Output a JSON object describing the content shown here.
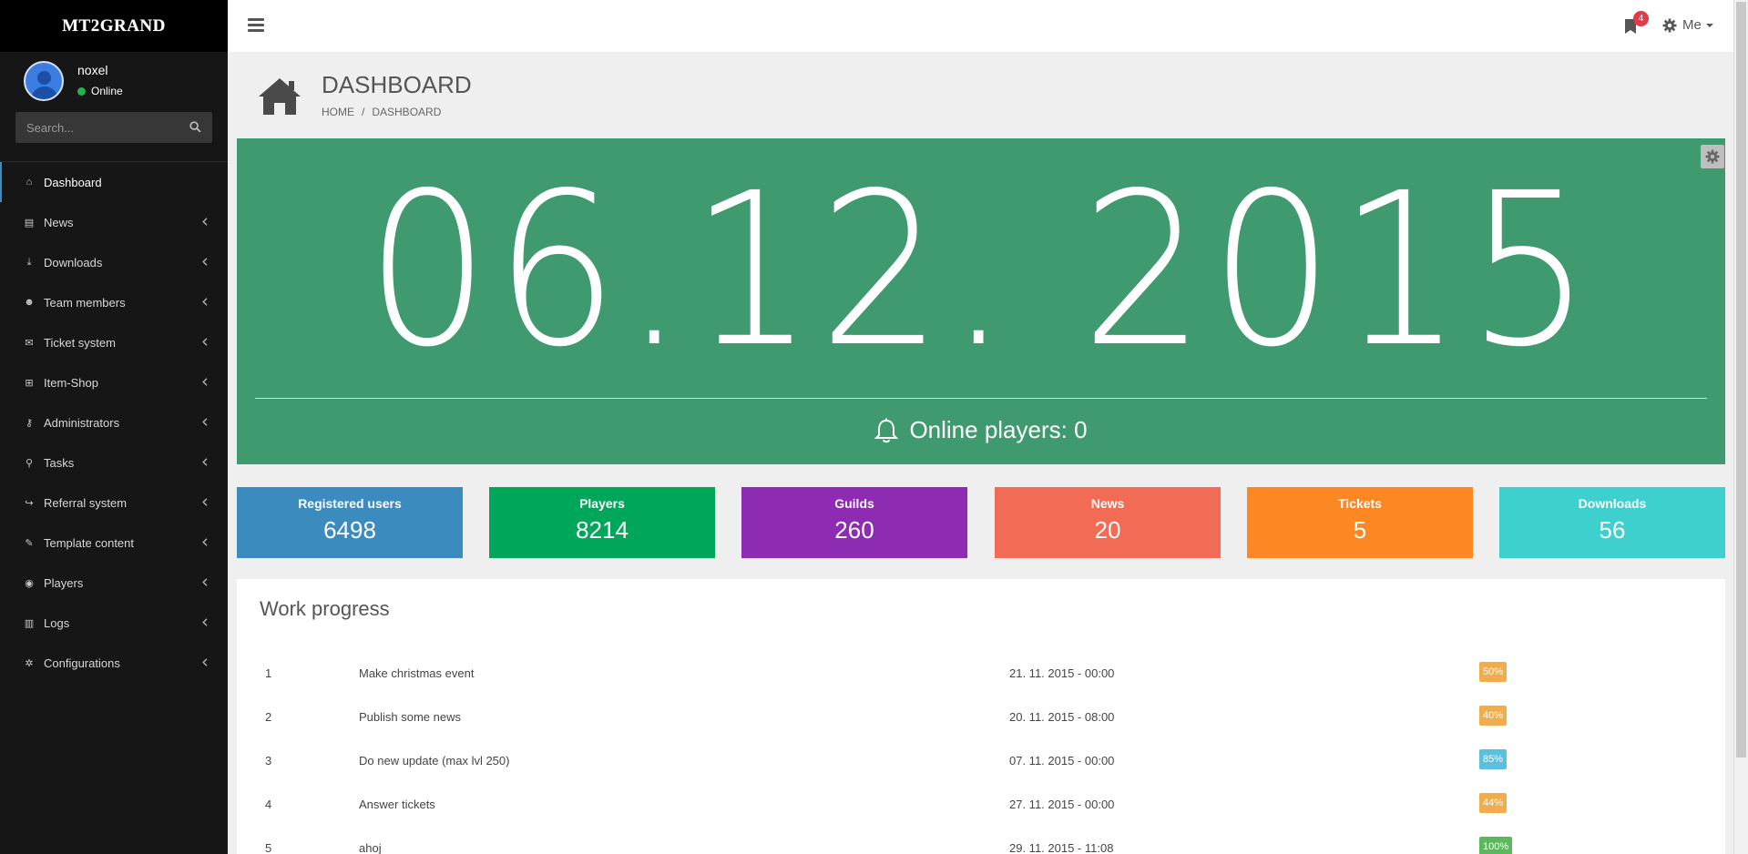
{
  "brand": {
    "name": "MT2GRAND",
    "suffix": ""
  },
  "user": {
    "name": "noxel",
    "status": "Online",
    "status_color": "#20b64d"
  },
  "search": {
    "placeholder": "Search..."
  },
  "menu": [
    {
      "label": "Dashboard",
      "icon": "home-icon",
      "glyph": "⌂"
    },
    {
      "label": "News",
      "icon": "newspaper-icon",
      "glyph": "▤"
    },
    {
      "label": "Downloads",
      "icon": "download-icon",
      "glyph": "⤓"
    },
    {
      "label": "Team members",
      "icon": "users-icon",
      "glyph": "☻"
    },
    {
      "label": "Ticket system",
      "icon": "envelope-icon",
      "glyph": "✉"
    },
    {
      "label": "Item-Shop",
      "icon": "cart-icon",
      "glyph": "⊞"
    },
    {
      "label": "Administrators",
      "icon": "key-icon",
      "glyph": "⚷"
    },
    {
      "label": "Tasks",
      "icon": "pin-icon",
      "glyph": "⚲"
    },
    {
      "label": "Referral system",
      "icon": "share-icon",
      "glyph": "↪"
    },
    {
      "label": "Template content",
      "icon": "pencil-icon",
      "glyph": "✎"
    },
    {
      "label": "Players",
      "icon": "gamepad-icon",
      "glyph": "◉"
    },
    {
      "label": "Logs",
      "icon": "book-icon",
      "glyph": "▥"
    },
    {
      "label": "Configurations",
      "icon": "gear-icon",
      "glyph": "✲"
    }
  ],
  "topbar": {
    "notifications_count": "4",
    "account_label": "Me"
  },
  "page": {
    "title": "DASHBOARD",
    "breadcrumb_home": "HOME",
    "breadcrumb_sep": "/",
    "breadcrumb_current": "DASHBOARD"
  },
  "hero": {
    "date": "06.12. 2015",
    "online_text": "Online players: 0",
    "bg_color": "#3f9a70"
  },
  "stats": [
    {
      "label": "Registered users",
      "value": "6498",
      "color": "#3c8bbf"
    },
    {
      "label": "Players",
      "value": "8214",
      "color": "#00a65a"
    },
    {
      "label": "Guilds",
      "value": "260",
      "color": "#8e2bb3"
    },
    {
      "label": "News",
      "value": "20",
      "color": "#f26b55"
    },
    {
      "label": "Tickets",
      "value": "5",
      "color": "#fd8722"
    },
    {
      "label": "Downloads",
      "value": "56",
      "color": "#3ecfcf"
    }
  ],
  "work_progress": {
    "title": "Work progress",
    "rows": [
      {
        "id": "1",
        "task": "Make christmas event",
        "date": "21. 11. 2015 - 00:00",
        "progress": "50%",
        "color": "#f0ad4e"
      },
      {
        "id": "2",
        "task": "Publish some news",
        "date": "20. 11. 2015 - 08:00",
        "progress": "40%",
        "color": "#f0ad4e"
      },
      {
        "id": "3",
        "task": "Do new update (max lvl 250)",
        "date": "07. 11. 2015 - 00:00",
        "progress": "85%",
        "color": "#5bc0de"
      },
      {
        "id": "4",
        "task": "Answer tickets",
        "date": "27. 11. 2015 - 00:00",
        "progress": "44%",
        "color": "#f0ad4e"
      },
      {
        "id": "5",
        "task": "ahoj",
        "date": "29. 11. 2015 - 11:08",
        "progress": "100%",
        "color": "#5cb85c"
      }
    ]
  }
}
